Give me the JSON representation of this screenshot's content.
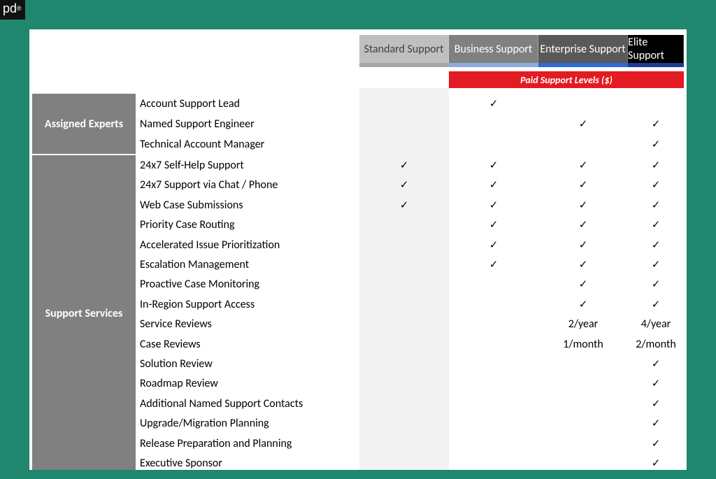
{
  "logo_text": "pd",
  "headers": {
    "standard": "Standard Support",
    "business": "Business Support",
    "enterprise": "Enterprise Support",
    "elite": "Elite Support"
  },
  "paid_bar": "Paid Support Levels ($)",
  "sidebar": {
    "experts": "Assigned Experts",
    "services": "Support Services"
  },
  "matrix": {
    "groups": [
      {
        "id": "experts",
        "rows": [
          {
            "label": "Account Support Lead",
            "standard": "",
            "business": "✓",
            "enterprise": "",
            "elite": ""
          },
          {
            "label": "Named Support Engineer",
            "standard": "",
            "business": "",
            "enterprise": "✓",
            "elite": "✓"
          },
          {
            "label": "Technical Account Manager",
            "standard": "",
            "business": "",
            "enterprise": "",
            "elite": "✓"
          }
        ]
      },
      {
        "id": "services",
        "rows": [
          {
            "label": "24x7 Self-Help Support",
            "standard": "✓",
            "business": "✓",
            "enterprise": "✓",
            "elite": "✓"
          },
          {
            "label": "24x7 Support via Chat / Phone",
            "standard": "✓",
            "business": "✓",
            "enterprise": "✓",
            "elite": "✓"
          },
          {
            "label": "Web Case Submissions",
            "standard": "✓",
            "business": "✓",
            "enterprise": "✓",
            "elite": "✓"
          },
          {
            "label": "Priority Case Routing",
            "standard": "",
            "business": "✓",
            "enterprise": "✓",
            "elite": "✓"
          },
          {
            "label": "Accelerated Issue Prioritization",
            "standard": "",
            "business": "✓",
            "enterprise": "✓",
            "elite": "✓"
          },
          {
            "label": "Escalation Management",
            "standard": "",
            "business": "✓",
            "enterprise": "✓",
            "elite": "✓"
          },
          {
            "label": "Proactive Case Monitoring",
            "standard": "",
            "business": "",
            "enterprise": "✓",
            "elite": "✓"
          },
          {
            "label": "In-Region Support Access",
            "standard": "",
            "business": "",
            "enterprise": "✓",
            "elite": "✓"
          },
          {
            "label": "Service Reviews",
            "standard": "",
            "business": "",
            "enterprise": "2/year",
            "elite": "4/year"
          },
          {
            "label": "Case Reviews",
            "standard": "",
            "business": "",
            "enterprise": "1/month",
            "elite": "2/month"
          },
          {
            "label": "Solution Review",
            "standard": "",
            "business": "",
            "enterprise": "",
            "elite": "✓"
          },
          {
            "label": "Roadmap Review",
            "standard": "",
            "business": "",
            "enterprise": "",
            "elite": "✓"
          },
          {
            "label": "Additional Named Support Contacts",
            "standard": "",
            "business": "",
            "enterprise": "",
            "elite": "✓"
          },
          {
            "label": "Upgrade/Migration Planning",
            "standard": "",
            "business": "",
            "enterprise": "",
            "elite": "✓"
          },
          {
            "label": "Release Preparation and Planning",
            "standard": "",
            "business": "",
            "enterprise": "",
            "elite": "✓"
          },
          {
            "label": "Executive Sponsor",
            "standard": "",
            "business": "",
            "enterprise": "",
            "elite": "✓"
          }
        ]
      }
    ]
  }
}
